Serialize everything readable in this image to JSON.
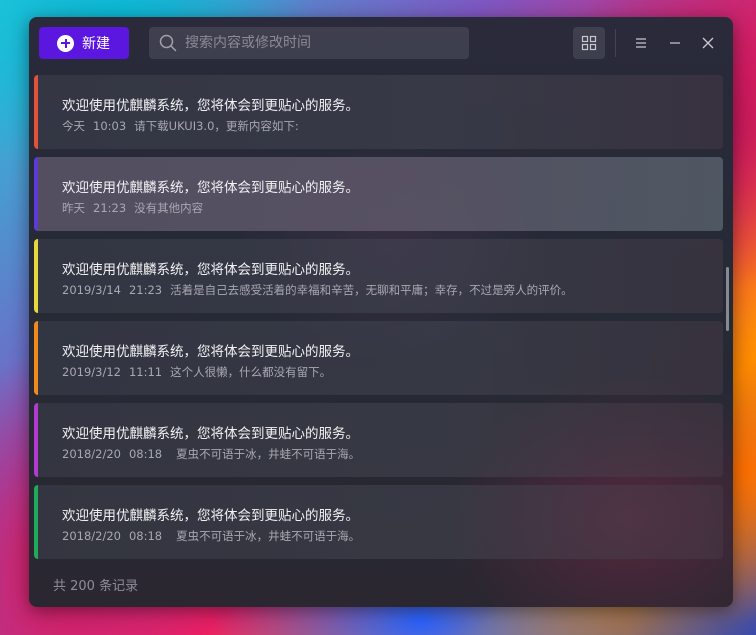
{
  "toolbar": {
    "new_label": "新建",
    "search_placeholder": "搜索内容或修改时间"
  },
  "notes": [
    {
      "title": "欢迎使用优麒麟系统，您将体会到更贴心的服务。",
      "date": "今天",
      "time": "10:03",
      "preview": "请下载UKUI3.0，更新内容如下:",
      "accent": "#e0523a"
    },
    {
      "title": "欢迎使用优麒麟系统，您将体会到更贴心的服务。",
      "date": "昨天",
      "time": "21:23",
      "preview": "没有其他内容",
      "accent": "#5b3ad6"
    },
    {
      "title": "欢迎使用优麒麟系统，您将体会到更贴心的服务。",
      "date": "2019/3/14",
      "time": "21:23",
      "preview": "活着是自己去感受活着的幸福和辛苦，无聊和平庸；幸存，不过是旁人的评价。",
      "accent": "#e6d83a"
    },
    {
      "title": "欢迎使用优麒麟系统，您将体会到更贴心的服务。",
      "date": "2019/3/12",
      "time": "11:11",
      "preview": "这个人很懒，什么都没有留下。",
      "accent": "#f08a1c"
    },
    {
      "title": "欢迎使用优麒麟系统，您将体会到更贴心的服务。",
      "date": "2018/2/20",
      "time": "08:18",
      "preview": "夏虫不可语于冰，井蛙不可语于海。",
      "accent": "#b23ad0"
    },
    {
      "title": "欢迎使用优麒麟系统，您将体会到更贴心的服务。",
      "date": "2018/2/20",
      "time": "08:18",
      "preview": "夏虫不可语于冰，井蛙不可语于海。",
      "accent": "#1faa5c"
    }
  ],
  "footer": {
    "count_label": "共 200 条记录"
  },
  "colors": {
    "brand": "#5b16e0"
  }
}
